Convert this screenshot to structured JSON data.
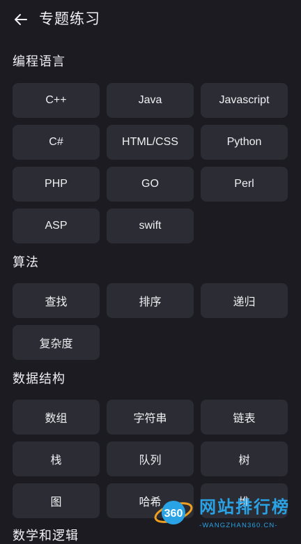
{
  "header": {
    "title": "专题练习",
    "back_icon": "arrow-left-icon"
  },
  "sections": [
    {
      "title": "编程语言",
      "items": [
        "C++",
        "Java",
        "Javascript",
        "C#",
        "HTML/CSS",
        "Python",
        "PHP",
        "GO",
        "Perl",
        "ASP",
        "swift"
      ]
    },
    {
      "title": "算法",
      "items": [
        "查找",
        "排序",
        "递归",
        "复杂度"
      ]
    },
    {
      "title": "数据结构",
      "items": [
        "数组",
        "字符串",
        "链表",
        "栈",
        "队列",
        "树",
        "图",
        "哈希",
        "堆"
      ]
    },
    {
      "title": "数学和逻辑",
      "items": []
    }
  ],
  "watermark": {
    "logo_text": "360",
    "title": "网站排行榜",
    "subtitle": "-WANGZHAN360.CN-"
  },
  "colors": {
    "background": "#1b1b21",
    "tile": "#2b2c34",
    "text": "#f0f0f3",
    "watermark": "#2aa3e6"
  }
}
